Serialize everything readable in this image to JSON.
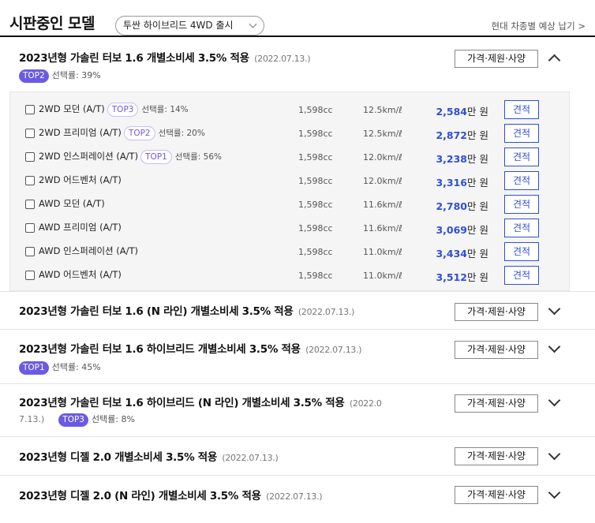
{
  "header": {
    "title": "시판중인 모델",
    "model_select": "투싼 하이브리드 4WD 출시",
    "link": "현대 차종별 예상 납기 >"
  },
  "spec_button_label": "가격·제원·사양",
  "estimate_label": "견적",
  "rate_prefix": "선택률: ",
  "groups": [
    {
      "title": "2023년형 가솔린 터보 1.6 개별소비세 3.5% 적용",
      "date": "(2022.07.13.)",
      "badge": "TOP2",
      "rate": "선택률: 39%",
      "expanded": true
    },
    {
      "title": "2023년형 가솔린 터보 1.6 (N 라인) 개별소비세 3.5% 적용",
      "date": "(2022.07.13.)",
      "expanded": false
    },
    {
      "title": "2023년형 가솔린 터보 1.6 하이브리드 개별소비세 3.5% 적용",
      "date": "(2022.07.13.)",
      "badge": "TOP1",
      "rate": "선택률: 45%",
      "expanded": false
    },
    {
      "title": "2023년형 가솔린 터보 1.6 하이브리드 (N 라인) 개별소비세 3.5% 적용",
      "date_part1": "(2022.0",
      "date_part2": "7.13.)",
      "badge": "TOP3",
      "rate": "선택률: 8%",
      "expanded": false
    },
    {
      "title": "2023년형 디젤 2.0 개별소비세 3.5% 적용",
      "date": "(2022.07.13.)",
      "expanded": false
    },
    {
      "title": "2023년형 디젤 2.0 (N 라인) 개별소비세 3.5% 적용",
      "date": "(2022.07.13.)",
      "expanded": false
    }
  ],
  "trims": [
    {
      "name": "2WD 모던 (A/T)",
      "badge": "TOP3",
      "rate": "선택률: 14%",
      "cc": "1,598cc",
      "eff": "12.5km/ℓ",
      "price": "2,584",
      "unit": "만 원"
    },
    {
      "name": "2WD 프리미엄 (A/T)",
      "badge": "TOP2",
      "rate": "선택률: 20%",
      "cc": "1,598cc",
      "eff": "12.5km/ℓ",
      "price": "2,872",
      "unit": "만 원"
    },
    {
      "name": "2WD 인스퍼레이션 (A/T)",
      "badge": "TOP1",
      "rate": "선택률: 56%",
      "cc": "1,598cc",
      "eff": "12.0km/ℓ",
      "price": "3,238",
      "unit": "만 원"
    },
    {
      "name": "2WD 어드벤처 (A/T)",
      "cc": "1,598cc",
      "eff": "12.0km/ℓ",
      "price": "3,316",
      "unit": "만 원"
    },
    {
      "name": "AWD 모던 (A/T)",
      "cc": "1,598cc",
      "eff": "11.6km/ℓ",
      "price": "2,780",
      "unit": "만 원"
    },
    {
      "name": "AWD 프리미엄 (A/T)",
      "cc": "1,598cc",
      "eff": "11.6km/ℓ",
      "price": "3,069",
      "unit": "만 원"
    },
    {
      "name": "AWD 인스퍼레이션 (A/T)",
      "cc": "1,598cc",
      "eff": "11.0km/ℓ",
      "price": "3,434",
      "unit": "만 원"
    },
    {
      "name": "AWD 어드벤처 (A/T)",
      "cc": "1,598cc",
      "eff": "11.0km/ℓ",
      "price": "3,512",
      "unit": "만 원"
    }
  ]
}
